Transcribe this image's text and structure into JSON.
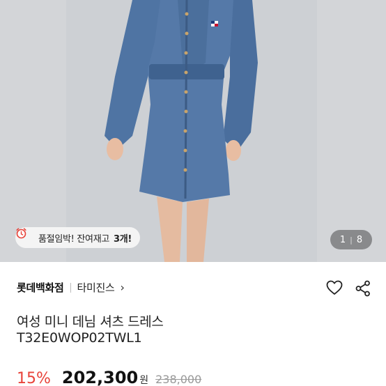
{
  "image": {
    "alt_icon": "product-photo",
    "counter_current": "1",
    "counter_separator": "|",
    "counter_total": "8"
  },
  "stock_badge": {
    "icon": "alarm-clock-icon",
    "text": "품절임박! 잔여재고",
    "count": "3개!"
  },
  "brand": {
    "store": "롯데백화점",
    "name": "타미진스",
    "chevron": "›"
  },
  "actions": {
    "like_icon": "heart-icon",
    "share_icon": "share-icon"
  },
  "product": {
    "name": "여성 미니 데님 셔츠 드레스",
    "code": "T32E0WOP02TWL1"
  },
  "price": {
    "discount": "15%",
    "sale": "202,300",
    "currency": "원",
    "original": "238,000"
  },
  "colors": {
    "discount": "#e8433a",
    "denim": "#4b6f9c"
  }
}
